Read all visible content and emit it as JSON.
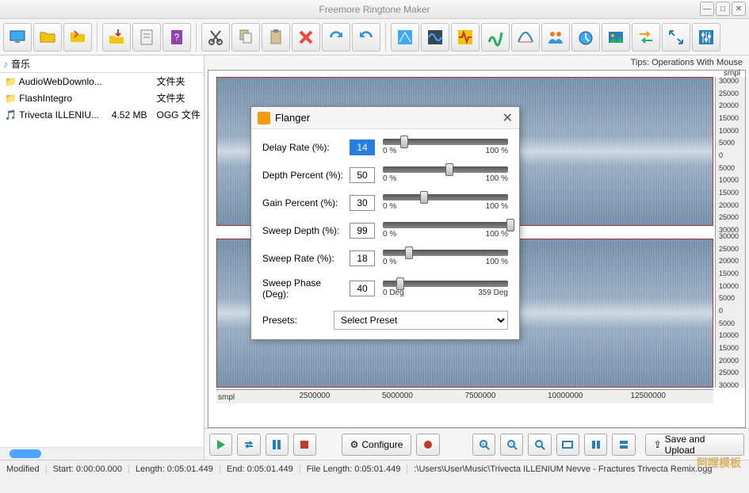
{
  "title": "Freemore Ringtone Maker",
  "breadcrumb": "音乐",
  "tips_label": "Tips: Operations With Mouse",
  "files": [
    {
      "name": "AudioWebDownlo...",
      "size": "",
      "type": "文件夹",
      "icon": "folder"
    },
    {
      "name": "FlashIntegro",
      "size": "",
      "type": "文件夹",
      "icon": "folder"
    },
    {
      "name": "Trivecta ILLENIU...",
      "size": "4.52 MB",
      "type": "OGG 文件",
      "icon": "file"
    }
  ],
  "ruler_x": [
    "2500000",
    "5000000",
    "7500000",
    "10000000",
    "12500000"
  ],
  "ruler_x_unit": "smpl",
  "ruler_y_unit": "smpl",
  "ruler_y": [
    "30000",
    "25000",
    "20000",
    "15000",
    "10000",
    "5000",
    "0",
    "5000",
    "10000",
    "15000",
    "20000",
    "25000",
    "30000"
  ],
  "dialog": {
    "title": "Flanger",
    "params": [
      {
        "label": "Delay Rate (%):",
        "value": "14",
        "min": "0 %",
        "max": "100 %",
        "pos": 14,
        "hl": true
      },
      {
        "label": "Depth Percent (%):",
        "value": "50",
        "min": "0 %",
        "max": "100 %",
        "pos": 50,
        "hl": false
      },
      {
        "label": "Gain Percent (%):",
        "value": "30",
        "min": "0 %",
        "max": "100 %",
        "pos": 30,
        "hl": false
      },
      {
        "label": "Sweep Depth (%):",
        "value": "99",
        "min": "0 %",
        "max": "100 %",
        "pos": 99,
        "hl": false
      },
      {
        "label": "Sweep Rate (%):",
        "value": "18",
        "min": "0 %",
        "max": "100 %",
        "pos": 18,
        "hl": false
      },
      {
        "label": "Sweep Phase (Deg):",
        "value": "40",
        "min": "0 Deg",
        "max": "359 Deg",
        "pos": 11,
        "hl": false
      }
    ],
    "presets_label": "Presets:",
    "presets_placeholder": "Select Preset"
  },
  "transport": {
    "configure": "Configure",
    "save_upload": "Save and Upload"
  },
  "status": {
    "modified": "Modified",
    "start": "Start: 0:00:00.000",
    "length": "Length: 0:05:01.449",
    "end": "End: 0:05:01.449",
    "file_length": "File Length: 0:05:01.449",
    "path": ":\\Users\\User\\Music\\Trivecta ILLENIUM Nevve - Fractures Trivecta Remix.ogg"
  },
  "watermark": "阿哩模板"
}
